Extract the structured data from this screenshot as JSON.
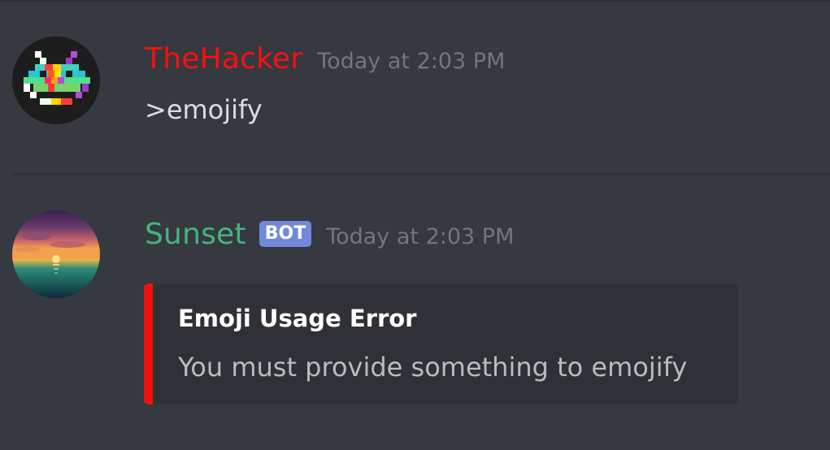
{
  "messages": [
    {
      "username": "TheHacker",
      "timestamp": "Today at 2:03 PM",
      "avatar_icon": "space-invader-avatar",
      "content": ">emojify"
    },
    {
      "username": "Sunset",
      "badge": "BOT",
      "timestamp": "Today at 2:03 PM",
      "avatar_icon": "sunset-avatar",
      "embed": {
        "accent_color": "#f10f0f",
        "title": "Emoji Usage Error",
        "description": "You must provide something to emojify"
      }
    }
  ],
  "colors": {
    "background": "#36393f",
    "user1_name": "#fb0f0f",
    "user2_name": "#43b581",
    "bot_badge": "#7289da",
    "timestamp": "#72767d",
    "embed_background": "#2f3136"
  }
}
